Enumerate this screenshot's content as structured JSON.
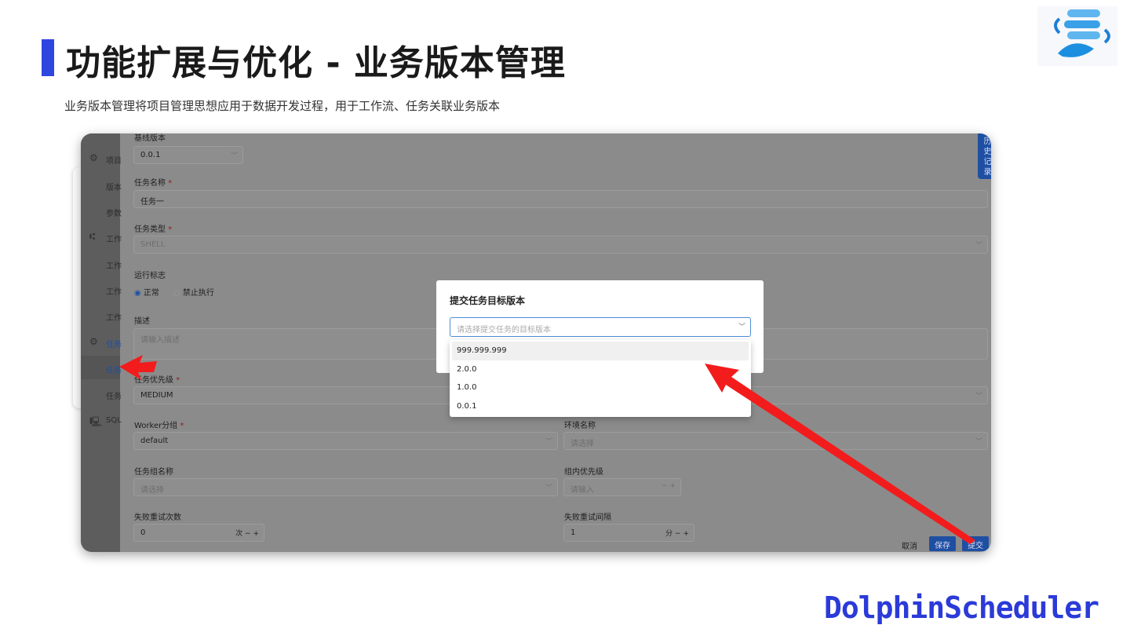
{
  "slide": {
    "title": "功能扩展与优化 - 业务版本管理",
    "subtitle": "业务版本管理将项目管理思想应用于数据开发过程，用于工作流、任务关联业务版本",
    "brand": "DolphinScheduler",
    "accent": "#2f45e0"
  },
  "sidebar": {
    "items": [
      "项目",
      "版本",
      "参数",
      "工作",
      "工作",
      "工作",
      "工作",
      "任务",
      "任务",
      "任务",
      "SQL"
    ]
  },
  "history_tab": "历史记录",
  "form": {
    "baseline_label": "基线版本",
    "baseline_value": "0.0.1",
    "name_label": "任务名称",
    "name_value": "任务一",
    "type_label": "任务类型",
    "type_value": "SHELL",
    "run_flag_label": "运行标志",
    "run_normal": "正常",
    "run_forbid": "禁止执行",
    "desc_label": "描述",
    "desc_placeholder": "请输入描述",
    "priority_label": "任务优先级",
    "priority_value": "MEDIUM",
    "worker_label": "Worker分组",
    "worker_value": "default",
    "env_label": "环境名称",
    "env_placeholder": "请选择",
    "group_label": "任务组名称",
    "group_placeholder": "请选择",
    "group_priority_label": "组内优先级",
    "group_priority_placeholder": "请输入",
    "retry_times_label": "失败重试次数",
    "retry_times_value": "0",
    "retry_times_unit": "次",
    "retry_interval_label": "失败重试间隔",
    "retry_interval_value": "1",
    "retry_interval_unit": "分",
    "required_mark": "*"
  },
  "footer": {
    "cancel": "取消",
    "save": "保存",
    "submit": "提交"
  },
  "dialog": {
    "title": "提交任务目标版本",
    "placeholder": "请选择提交任务的目标版本",
    "options": [
      "999.999.999",
      "2.0.0",
      "1.0.0",
      "0.0.1"
    ]
  }
}
